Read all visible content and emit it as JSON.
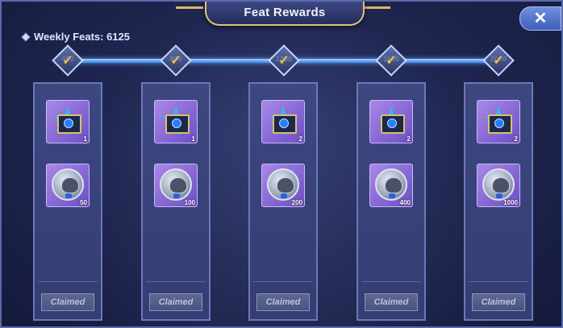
{
  "header": {
    "title": "Feat Rewards",
    "close_label": "✕"
  },
  "weekly_feats": {
    "label": "Weekly Feats: 6125"
  },
  "milestones": [
    {
      "points": "400",
      "reached": true
    },
    {
      "points": "800",
      "reached": true
    },
    {
      "points": "1200",
      "reached": true
    },
    {
      "points": "1600",
      "reached": true
    },
    {
      "points": "2000",
      "reached": true
    }
  ],
  "check_glyph": "✓",
  "columns": [
    {
      "chest_qty": "1",
      "coin_qty": "50",
      "status": "Claimed"
    },
    {
      "chest_qty": "1",
      "coin_qty": "100",
      "status": "Claimed"
    },
    {
      "chest_qty": "2",
      "coin_qty": "200",
      "status": "Claimed"
    },
    {
      "chest_qty": "2",
      "coin_qty": "400",
      "status": "Claimed"
    },
    {
      "chest_qty": "2",
      "coin_qty": "1000",
      "status": "Claimed"
    }
  ],
  "icons": {
    "chest": "reward-chest-icon",
    "coin": "silver-coin-icon",
    "close": "close-icon"
  },
  "colors": {
    "accent": "#3f7fe0",
    "gold": "#e0c27a",
    "item_bg": "#8a6ad8"
  }
}
